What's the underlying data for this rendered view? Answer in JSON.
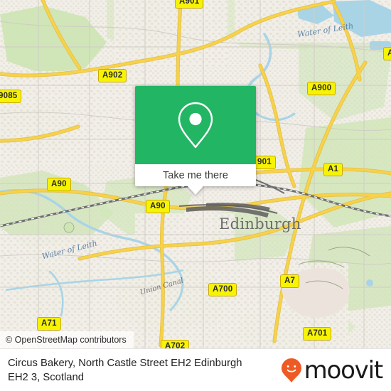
{
  "map": {
    "alt": "OpenStreetMap view of Edinburgh, Scotland",
    "attribution": "© OpenStreetMap contributors",
    "place_labels": [
      {
        "name": "Edinburgh",
        "kind": "city"
      },
      {
        "name": "Water of Leith",
        "kind": "water"
      },
      {
        "name": "Water of Leith",
        "kind": "water"
      },
      {
        "name": "Union Canal",
        "kind": "canal"
      }
    ],
    "road_shields": [
      {
        "label": "A901"
      },
      {
        "label": "A902"
      },
      {
        "label": "9085"
      },
      {
        "label": "A900"
      },
      {
        "label": "A"
      },
      {
        "label": "A90"
      },
      {
        "label": "A90"
      },
      {
        "label": "901"
      },
      {
        "label": "A1"
      },
      {
        "label": "A71"
      },
      {
        "label": "A700"
      },
      {
        "label": "A702"
      },
      {
        "label": "A7"
      },
      {
        "label": "A701"
      }
    ],
    "colors": {
      "land": "#f2efe9",
      "green": "#cfe5b6",
      "water": "#a9d4e6",
      "road_major": "#f7d24a",
      "road_shield_fill": "#f7f305",
      "rail": "#777777"
    }
  },
  "popup": {
    "icon": "map-pin-icon",
    "button_label": "Take me there",
    "accent_color": "#22b563"
  },
  "footer": {
    "address_line_1": "Circus Bakery, North Castle Street EH2 Edinburgh",
    "address_line_2": "EH2 3, Scotland",
    "brand_name": "moovit",
    "brand_icon": "moovit-pin-icon",
    "brand_color": "#ee5a24"
  }
}
